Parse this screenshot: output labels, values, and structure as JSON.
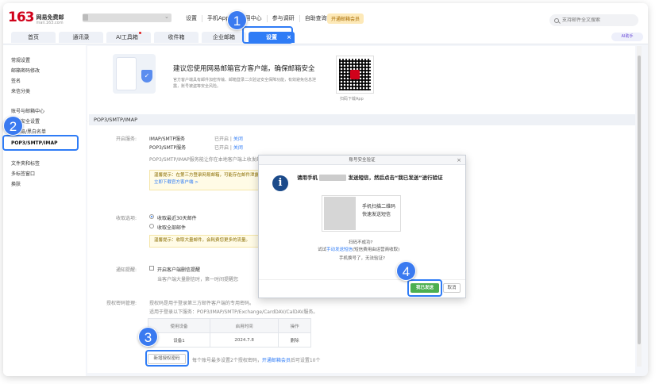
{
  "logo": {
    "number": "163",
    "name": "网易免费邮",
    "domain": "mail.163.com"
  },
  "topnav": [
    "设置",
    "手机App",
    "应用中心",
    "参与调研",
    "自助查询"
  ],
  "vip_badge": "开通邮箱会员",
  "search": {
    "placeholder": "支持邮件全文搜索"
  },
  "tabs": [
    {
      "label": "首页"
    },
    {
      "label": "通讯录"
    },
    {
      "label": "AI工具箱"
    },
    {
      "label": "收件箱"
    },
    {
      "label": "企业邮箱"
    },
    {
      "label": "设置",
      "close": "×"
    }
  ],
  "ai_button": "AI助手",
  "sidebar": [
    "常规设置",
    "邮箱密码修改",
    "签名",
    "来信分类",
    "账号与邮箱中心",
    "邮箱安全设置",
    "反垃圾/黑白名单",
    "POP3/SMTP/IMAP",
    "文件夹和标签",
    "多标签窗口",
    "换肤"
  ],
  "banner": {
    "title": "建议您使用网易邮箱官方客户端，确保邮箱安全",
    "desc": "官方客户端具有邮件加密传输、邮箱登录二次验证安全保障功能，有效避免信息泄露，账号被盗等安全风险。",
    "qr_caption": "扫码下载App"
  },
  "section_title": "POP3/SMTP/IMAP",
  "services": {
    "label": "开启服务:",
    "rows": [
      {
        "name": "IMAP/SMTP服务",
        "status": "已开启",
        "action": "关闭"
      },
      {
        "name": "POP3/SMTP服务",
        "status": "已开启",
        "action": "关闭"
      }
    ],
    "note": "POP3/SMTP/IMAP服务能让你在本地客户端上收发邮件",
    "tip_line1": "温馨提示：在第三方登录网易邮箱，可能存在邮件泄露风险，甚至危害",
    "tip_link": "立即下载官方客户端 >"
  },
  "receive": {
    "label": "收取选项:",
    "opt1": "收取最近30天邮件",
    "opt2": "收取全部邮件",
    "tip": "温馨提示：收取大量邮件，会耗费您更多的流量。"
  },
  "notify": {
    "label": "通知提醒:",
    "check": "开启客户端删信提醒",
    "desc": "当客户端大量删信时，第一时间提醒您"
  },
  "auth": {
    "label": "授权密码管理:",
    "line1": "授权码是用于登录第三方邮件客户端的专用密码。",
    "line2": "适用于登录以下服务：POP3/IMAP/SMTP/Exchange/CardDAV/CalDAV服务。",
    "table_headers": [
      "使用设备",
      "启用时间",
      "操作"
    ],
    "rows": [
      {
        "device": "设备1",
        "date": "2024.7.8",
        "action": "删除"
      }
    ],
    "new_button": "新增授权密码",
    "footer": "每个账号最多设置2个授权密码，",
    "footer_link": "开通邮箱会员",
    "footer_tail": "后可设置10个"
  },
  "dialog": {
    "title": "账号安全验证",
    "close": "×",
    "msg_pre": "请用手机",
    "msg_post": "发送短信，然后点击“我已发送”进行验证",
    "qr_text_1": "手机扫描二维码",
    "qr_text_2": "快速发送短信",
    "scan_fail": "扫码不成功?",
    "try_pre": "试试",
    "try_link": "手动发送短信",
    "try_post": "(短信费用由运营商收取)",
    "phone_change": "手机换号了，无法验证?",
    "sent_button": "我已发送",
    "cancel_button": "取消"
  },
  "callouts": [
    "1",
    "2",
    "3",
    "4"
  ],
  "colors": {
    "accent": "#2f7cf6",
    "brand": "#d0021b",
    "callout": "#3a7af0",
    "confirm": "#4caf50"
  }
}
